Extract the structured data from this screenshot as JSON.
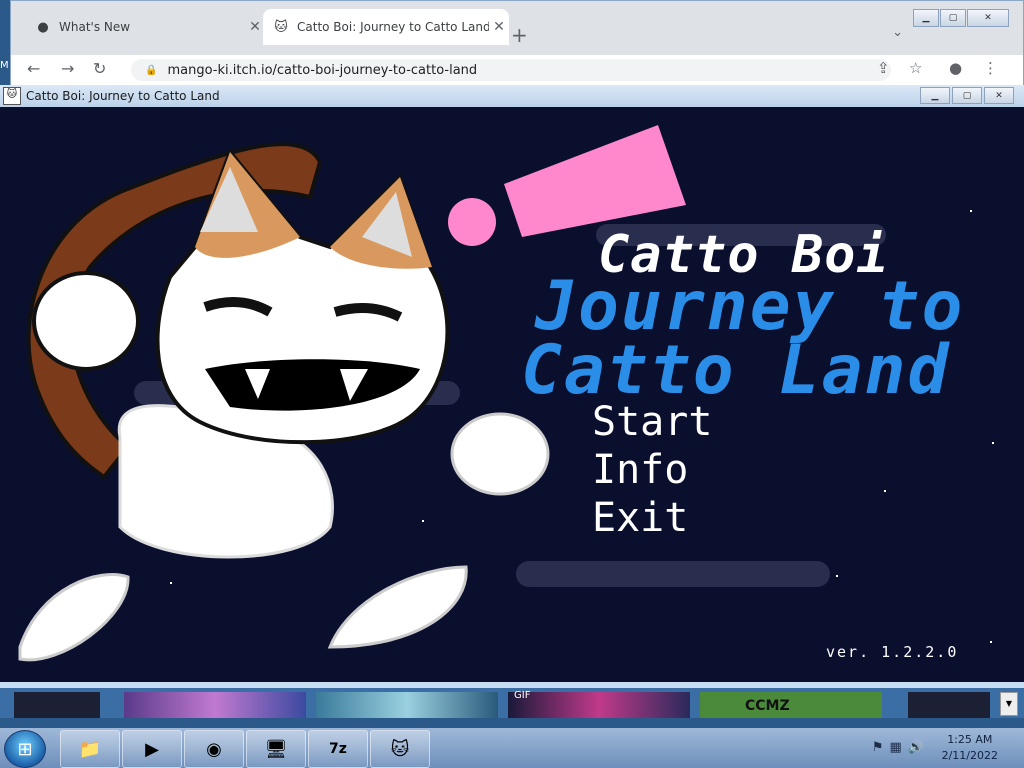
{
  "browser": {
    "tabs": [
      {
        "title": "What's New"
      },
      {
        "title": "Catto Boi: Journey to Catto Land"
      }
    ],
    "new_tab": "+",
    "url": "mango-ki.itch.io/catto-boi-journey-to-catto-land",
    "left_edge_text": "M"
  },
  "game_window": {
    "title": "Catto Boi: Journey to Catto Land"
  },
  "game": {
    "title_line1": "Catto Boi",
    "title_line2": "Journey to",
    "title_line3": "Catto Land",
    "menu": [
      "Start",
      "Info",
      "Exit"
    ],
    "version": "ver. 1.2.2.0",
    "colors": {
      "background": "#0b0f2e",
      "title_blue": "#2a8ee8",
      "pink": "#ff88cc"
    }
  },
  "strip": {
    "gif_label": "GIF",
    "ccmz_label": "CCMZ"
  },
  "taskbar": {
    "time": "1:25 AM",
    "date": "2/11/2022",
    "apps": [
      "windows-explorer",
      "media-player",
      "chrome",
      "control-panel",
      "7zip",
      "catto-boi"
    ]
  }
}
